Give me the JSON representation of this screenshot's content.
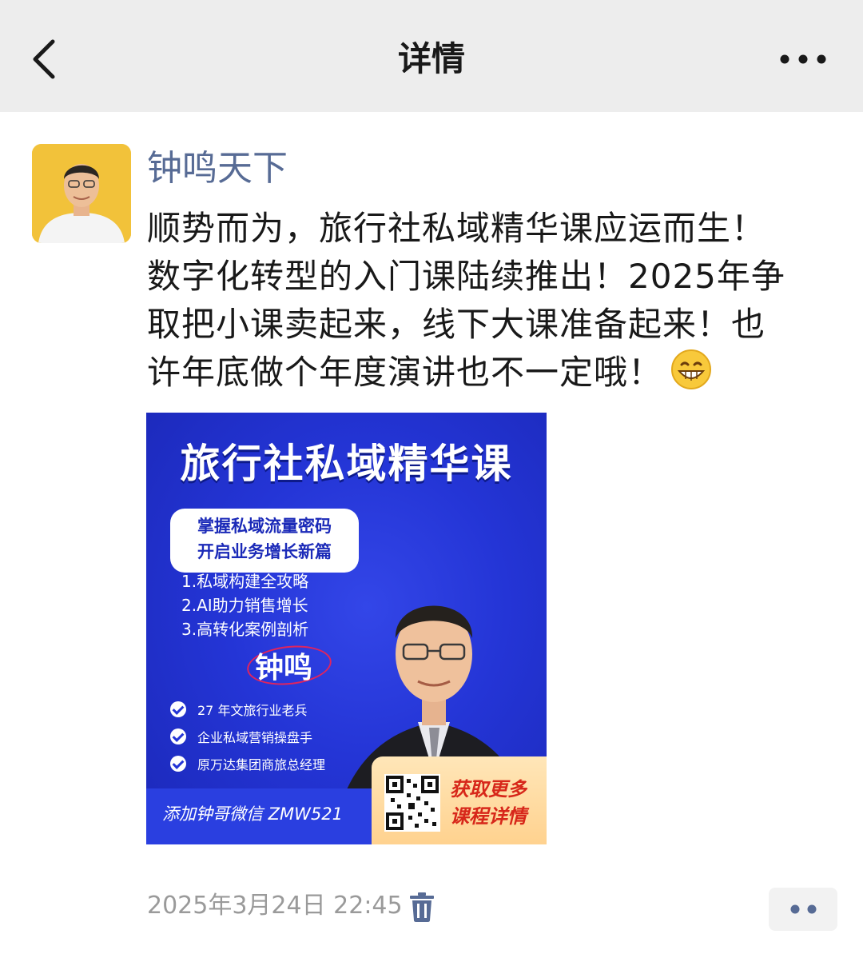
{
  "header": {
    "title": "详情",
    "back_icon": "chevron-left-icon",
    "more_icon": "more-horizontal-icon"
  },
  "post": {
    "author": "钟鸣天下",
    "text_lines": [
      "顺势而为，旅行社私域精华课应运而生！",
      "数字化转型的入门课陆续推出！2025年争",
      "取把小课卖起来，线下大课准备起来！也",
      "许年底做个年度演讲也不一定哦！"
    ],
    "emoji": "grin-emoji",
    "poster": {
      "title": "旅行社私域精华课",
      "box_lines": [
        "掌握私域流量密码",
        "开启业务增长新篇"
      ],
      "list": [
        "1.私域构建全攻略",
        "2.AI助力销售增长",
        "3.高转化案例剖析"
      ],
      "name": "钟鸣",
      "checks": [
        "27 年文旅行业老兵",
        "企业私域营销操盘手",
        "原万达集团商旅总经理"
      ],
      "wechat": "添加钟哥微信 ZMW521",
      "cta_lines": [
        "获取更多",
        "课程详情"
      ]
    },
    "timestamp": "2025年3月24日 22:45",
    "delete_icon": "trash-icon",
    "action_icon": "comment-dots-icon"
  },
  "colors": {
    "header_bg": "#ededed",
    "author_link": "#576b95",
    "poster_blue": "#2435d6",
    "cta_red": "#d7271a"
  }
}
